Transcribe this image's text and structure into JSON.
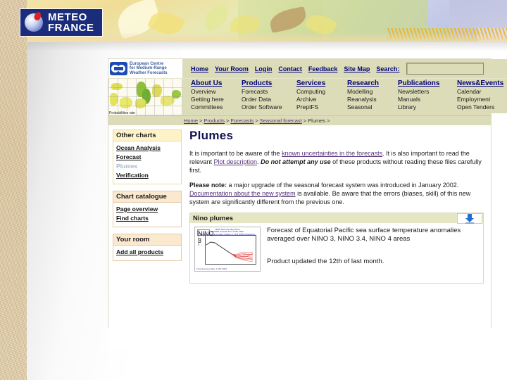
{
  "slide": {
    "logo": {
      "line1": "METEO",
      "line2": "FRANCE",
      "mark_name": "meteo-france-globe-mark"
    }
  },
  "site": {
    "org_name": "European Centre for Medium-Range Weather Forecasts",
    "org_name_lines": [
      "European Centre",
      "for Medium-Range",
      "Weather Forecasts"
    ],
    "map_caption": "Probabilities rain",
    "top_links": [
      "Home",
      "Your Room",
      "Login",
      "Contact",
      "Feedback",
      "Site Map"
    ],
    "search_label": "Search:",
    "search_value": "",
    "search_placeholder": "",
    "menu_columns": [
      {
        "head": "About Us",
        "items": [
          "Overview",
          "Getting here",
          "Committees"
        ]
      },
      {
        "head": "Products",
        "items": [
          "Forecasts",
          "Order Data",
          "Order Software"
        ]
      },
      {
        "head": "Services",
        "items": [
          "Computing",
          "Archive",
          "PrepIFS"
        ]
      },
      {
        "head": "Research",
        "items": [
          "Modelling",
          "Reanalysis",
          "Seasonal"
        ]
      },
      {
        "head": "Publications",
        "items": [
          "Newsletters",
          "Manuals",
          "Library"
        ]
      },
      {
        "head": "News&Events",
        "items": [
          "Calendar",
          "Employment",
          "Open Tenders"
        ]
      }
    ],
    "breadcrumb": [
      "Home",
      "Products",
      "Forecasts",
      "Seasonal forecast",
      "Plumes"
    ]
  },
  "sidebar": {
    "panels": [
      {
        "title": "Other charts",
        "links": [
          {
            "label": "Ocean Analysis",
            "current": false
          },
          {
            "label": "Forecast",
            "current": false
          },
          {
            "label": "Plumes",
            "current": true
          },
          {
            "label": "Verification",
            "current": false
          }
        ]
      },
      {
        "title": "Chart catalogue",
        "links": [
          {
            "label": "Page overview",
            "current": false
          },
          {
            "label": "Find charts",
            "current": false
          }
        ]
      },
      {
        "title": "Your room",
        "links": [
          {
            "label": "Add all products",
            "current": false
          }
        ]
      }
    ]
  },
  "main": {
    "title": "Plumes",
    "para1": {
      "t1": "It is important to be aware of the ",
      "link1": "known uncertainties in the forecasts",
      "t2": ". It is also important to read the relevant ",
      "link2": "Plot description",
      "t3": ". ",
      "strong": "Do not attempt any use",
      "t4": " of these products without reading these files carefully first."
    },
    "para2": {
      "label": "Please note:",
      "t1": " a major upgrade of the seasonal forecast system was introduced in January 2002. ",
      "link1": "Documentation about the new system",
      "t2": " is available. Be aware that the errors (biases, skill) of this new system are significantly different from the previous one."
    },
    "product": {
      "title": "Nino plumes",
      "download_icon": "download-arrow-icon",
      "description": "Forecast of Equatorial Pacific sea surface temperature anomalies averaged over NINO 3, NINO 3.4, NINO 4 areas",
      "updated": "Product updated the 12th of last month.",
      "thumbnail": {
        "title_lines": [
          "NINO SST anomaly plume",
          "ECMWF forecast from 1 Mar 2003",
          "monthly mean anomalies relative to 1971-2000 climatology"
        ],
        "ylabel": "anomaly (deg C)",
        "legend": "NINO 3",
        "footer": "Forecast issue date: 1 Mar 2003"
      }
    }
  },
  "colors": {
    "nav_bg": "#dcdcb8",
    "link_navy": "#00007a",
    "link_purple": "#55337a",
    "panel_orange": "#fbe9cf",
    "panel_yellow": "#fdf2c8",
    "title_navy": "#12124f",
    "download_blue": "#1e6fd0",
    "mf_navy": "#1b2d7a"
  }
}
